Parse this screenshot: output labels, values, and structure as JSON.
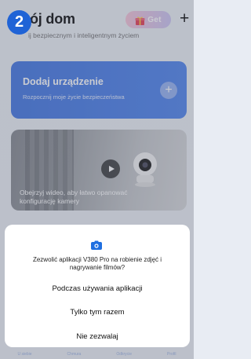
{
  "step": "2",
  "header": {
    "title": "ój dom",
    "subtitle": "ij bezpiecznym i inteligentnym życiem",
    "get_label": "Get",
    "plus_icon": "plus-icon"
  },
  "add_card": {
    "title": "Dodaj urządzenie",
    "subtitle": "Rozpocznij moje życie bezpieczeństwa",
    "plus": "+"
  },
  "video_card": {
    "caption": "Obejrzyj wideo, aby łatwo opanować konfigurację kamery"
  },
  "dialog": {
    "message": "Zezwolić aplikacji V380 Pro na robienie zdjęć i nagrywanie filmów?",
    "options": [
      "Podczas używania aplikacji",
      "Tylko tym razem",
      "Nie zezwalaj"
    ]
  },
  "bottom_nav": [
    "U siebie",
    "Chmura",
    "Odkrycie",
    "Profil"
  ],
  "colors": {
    "accent": "#1f63d6",
    "card_blue": "#5a8cef"
  }
}
